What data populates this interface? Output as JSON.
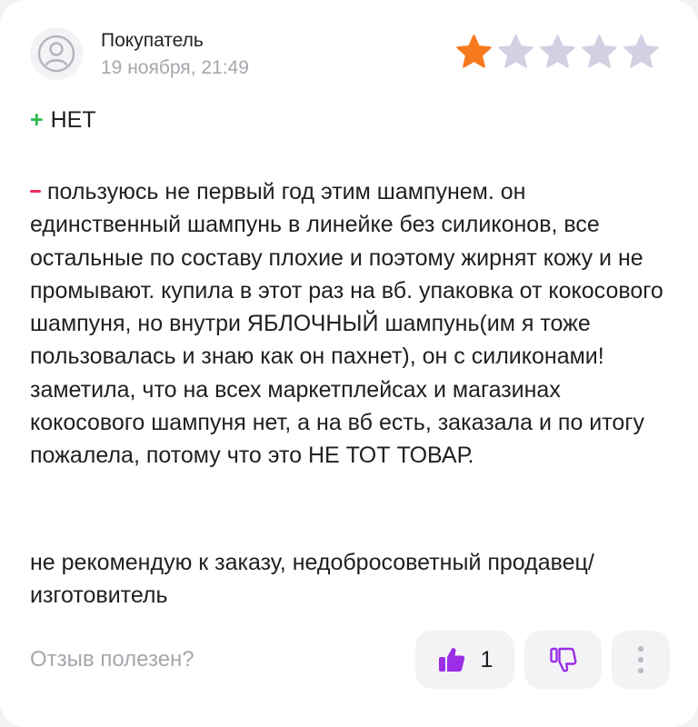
{
  "review": {
    "author": "Покупатель",
    "date": "19 ноября, 21:49",
    "rating": 1,
    "rating_max": 5,
    "pros_sign": "+",
    "pros_text": "НЕТ",
    "cons_text": "пользуюсь не первый год этим шампунем. он единственный шампунь в линейке без силиконов, все остальные по составу плохие и поэтому жирнят кожу и не промывают. купила в этот раз на вб. упаковка от кокосового шампуня, но внутри ЯБЛОЧНЫЙ шампунь(им я тоже пользовалась и знаю как он пахнет), он с силиконами! заметила, что на всех маркетплейсах и магазинах кокосового шампуня нет, а на вб есть, заказала и по итогу пожалела, потому что это НЕ ТОТ ТОВАР.",
    "comment": "не рекомендую к заказу, недобросоветный продавец/изготовитель"
  },
  "footer": {
    "helpful_question": "Отзыв полезен?",
    "like_count": "1"
  },
  "colors": {
    "star_filled": "#f7791e",
    "star_empty": "#d4cfe2",
    "accent_purple": "#9b2ee6",
    "plus_green": "#2eb84c",
    "minus_red": "#ea2d5f"
  },
  "icons": {
    "avatar": "user-sad-icon",
    "star": "star-icon",
    "like": "thumb-up-icon",
    "dislike": "thumb-down-icon",
    "more": "more-vertical-icon"
  }
}
